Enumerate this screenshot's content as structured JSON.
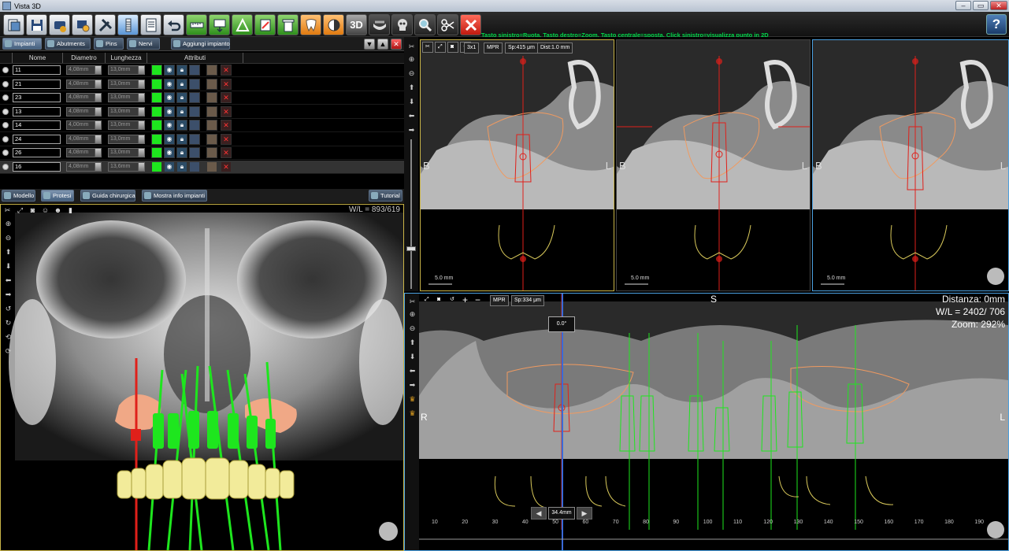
{
  "window": {
    "title": "Vista 3D",
    "min_label": "–",
    "max_label": "▭",
    "close_label": "✕"
  },
  "toolbar": {
    "icons": [
      "new-icon",
      "save-icon",
      "export-icon",
      "settings-icon",
      "tools-icon",
      "implant-icon",
      "report-icon",
      "undo-icon",
      "measure-icon",
      "annotate-icon",
      "angle-icon",
      "canal-icon",
      "delete-icon",
      "tooth-icon",
      "contrast-icon",
      "3d-toggle",
      "jaw-icon",
      "skull-icon",
      "magnifier-icon",
      "cut-icon",
      "close-icon",
      "help-icon"
    ],
    "three_d_label": "3D",
    "help_label": "?",
    "hint": "Tasto sinistro=Ruota, Tasto destro=Zoom, Tasto centrale=sposta, Click sinistro=visualizza punto in 2D"
  },
  "tabs": [
    {
      "label": "Impianti",
      "active": true
    },
    {
      "label": "Abutments",
      "active": false
    },
    {
      "label": "Pins",
      "active": false
    },
    {
      "label": "Nervi",
      "active": false
    },
    {
      "label": "Aggiungi impianto",
      "active": false
    }
  ],
  "table": {
    "headers": [
      "Nome",
      "Diametro",
      "Lunghezza",
      "Attributi"
    ],
    "rows": [
      {
        "name": "11",
        "diameter": "4,08mm",
        "length": "13,0mm"
      },
      {
        "name": "21",
        "diameter": "4,08mm",
        "length": "13,0mm"
      },
      {
        "name": "23",
        "diameter": "4,08mm",
        "length": "13,0mm"
      },
      {
        "name": "13",
        "diameter": "4,08mm",
        "length": "13,0mm"
      },
      {
        "name": "14",
        "diameter": "4,00mm",
        "length": "13,0mm"
      },
      {
        "name": "24",
        "diameter": "4,08mm",
        "length": "13,0mm"
      },
      {
        "name": "26",
        "diameter": "4,08mm",
        "length": "13,0mm"
      },
      {
        "name": "16",
        "diameter": "4,08mm",
        "length": "13,6mm"
      }
    ],
    "selected_index": 7
  },
  "bottom_tabs": [
    "Modello",
    "Protesi",
    "Guida chirurgica",
    "Mostra info impianti",
    "Tutorial"
  ],
  "view3d": {
    "wl": "W/L = 893/619",
    "accent": "#c9b447"
  },
  "mpr": {
    "layout_label": "3x1",
    "mode_label": "MPR",
    "spacing": "Sp:415 μm",
    "distance": "Dist:1.0 mm",
    "left_label": "B",
    "right_label": "L",
    "scale": "5.0 mm"
  },
  "panorama": {
    "mode_label": "MPR",
    "spacing": "Sp:334 μm",
    "top_label": "S",
    "left_label": "R",
    "right_label": "L",
    "distance": "Distanza: 0mm",
    "wl": "W/L = 2402/ 706",
    "zoom": "Zoom: 292%",
    "angle": "0.0°",
    "length": "34.4mm",
    "ruler_ticks": [
      "10",
      "20",
      "30",
      "40",
      "50",
      "60",
      "70",
      "80",
      "90",
      "100",
      "110",
      "120",
      "130",
      "140",
      "150",
      "160",
      "170",
      "180",
      "190"
    ],
    "accent": "#4aa0e0"
  },
  "colors": {
    "implant_green": "#1ee61e",
    "implant_red": "#e0201a",
    "contour_orange": "#f09a60",
    "hint_green": "#00d84a"
  }
}
